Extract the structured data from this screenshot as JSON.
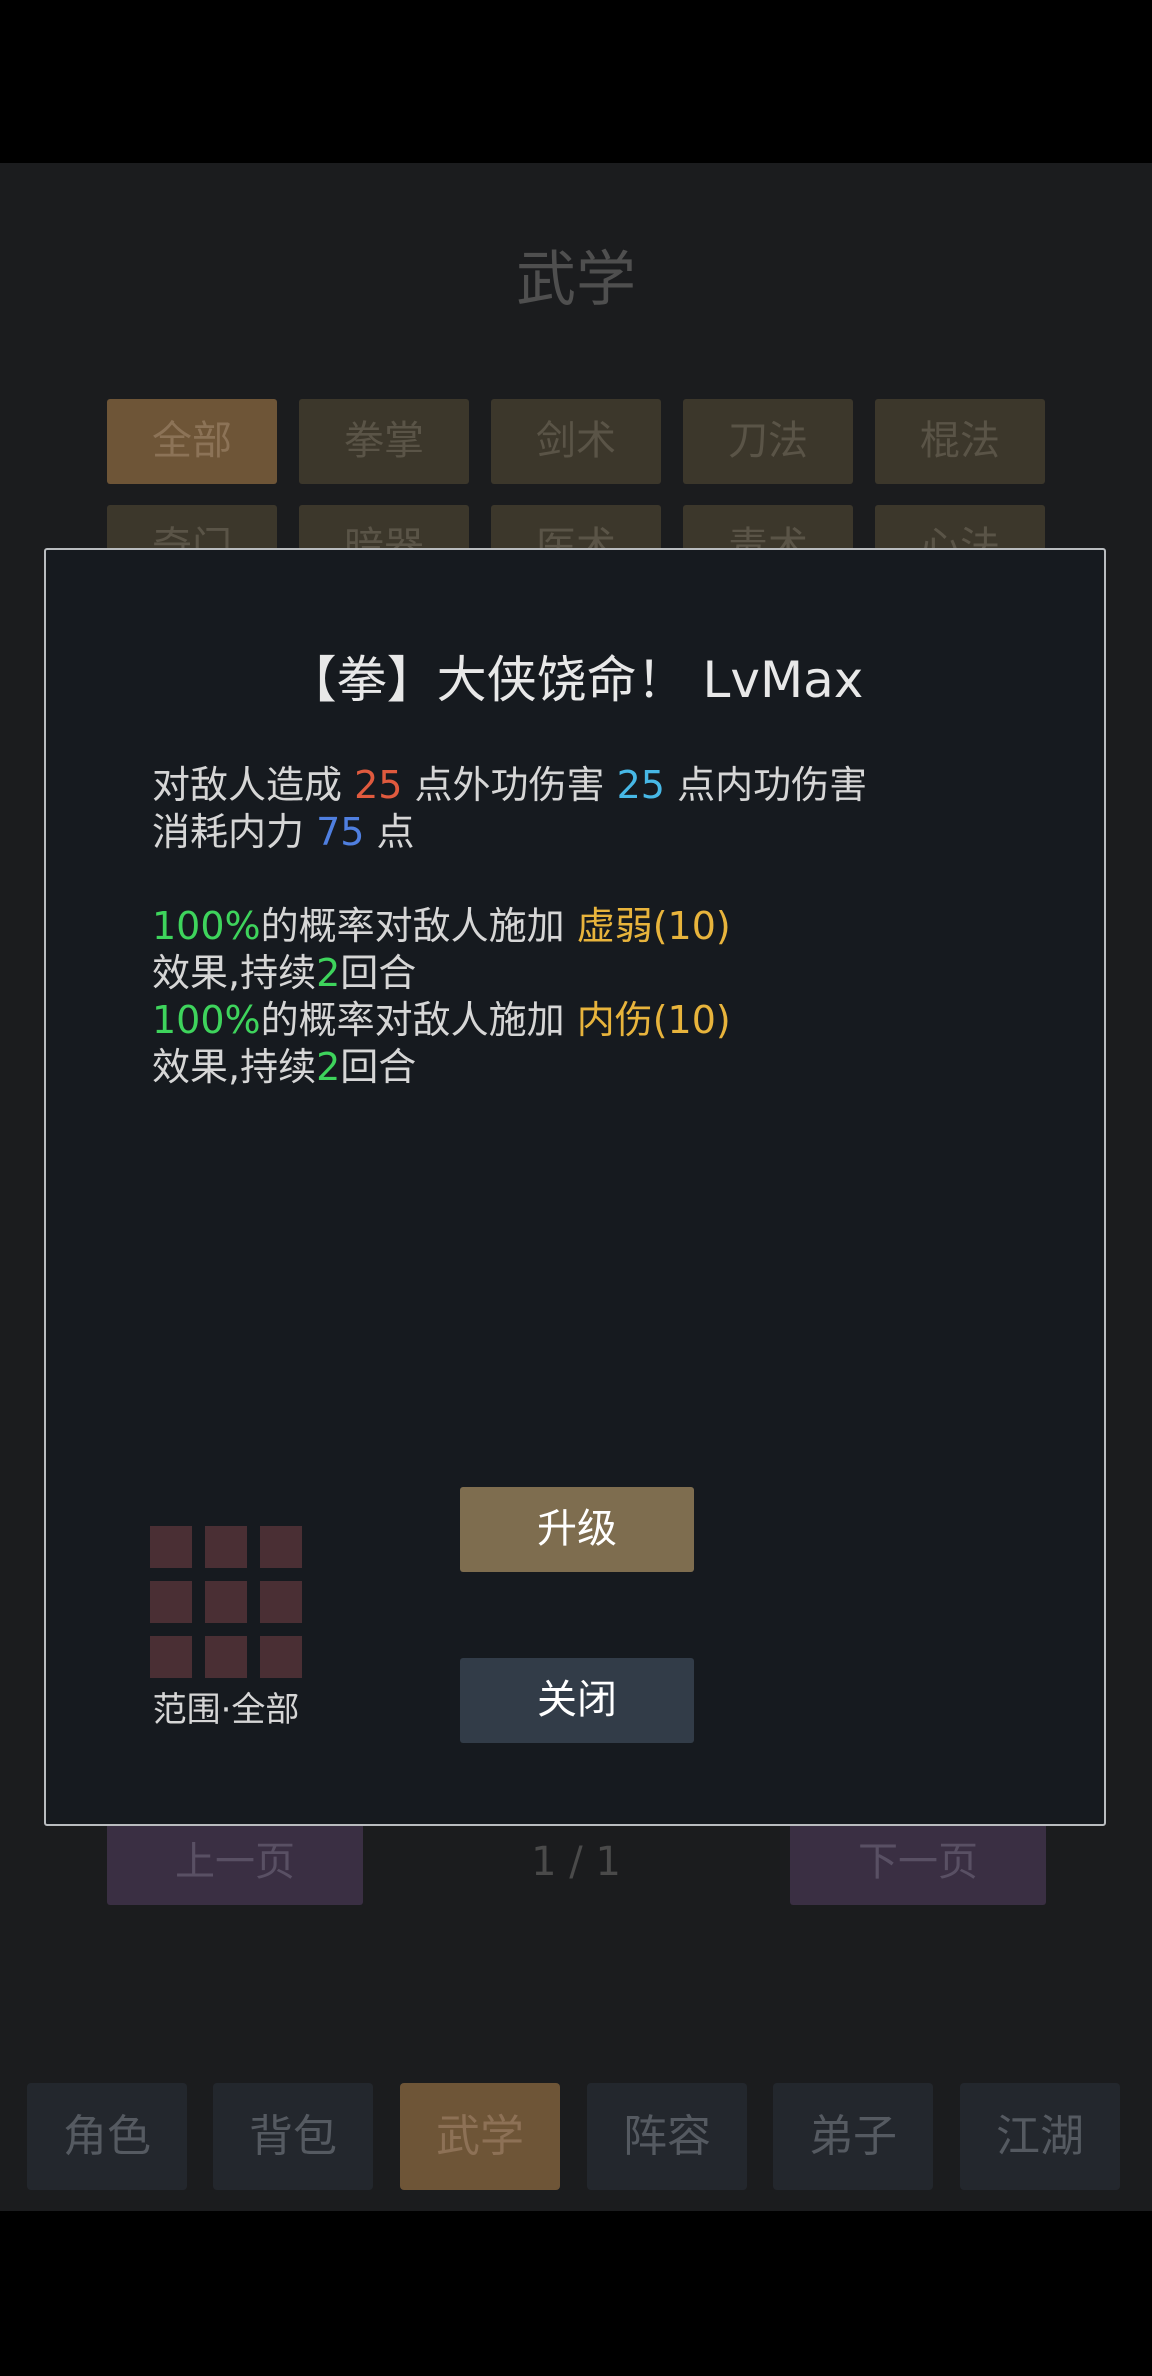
{
  "page": {
    "title": "武学"
  },
  "categories": [
    {
      "label": "全部"
    },
    {
      "label": "拳掌"
    },
    {
      "label": "剑术"
    },
    {
      "label": "刀法"
    },
    {
      "label": "棍法"
    },
    {
      "label": "奇门"
    },
    {
      "label": "暗器"
    },
    {
      "label": "医术"
    },
    {
      "label": "毒术"
    },
    {
      "label": "心法"
    }
  ],
  "pager": {
    "prev_label": "上一页",
    "page_text": "1 / 1",
    "next_label": "下一页"
  },
  "bottom_nav": [
    {
      "label": "角色"
    },
    {
      "label": "背包"
    },
    {
      "label": "武学"
    },
    {
      "label": "阵容"
    },
    {
      "label": "弟子"
    },
    {
      "label": "江湖"
    }
  ],
  "colors": {
    "damage_outer": "#e05a3e",
    "damage_inner": "#47b8e6",
    "mana": "#4f7fe0",
    "chance": "#3ed45c",
    "effect": "#e8b43c"
  },
  "modal": {
    "title": "【拳】大侠饶命！ LvMax",
    "desc": {
      "line1_a": "对敌人造成 ",
      "outer_damage": "25",
      "line1_b": " 点外功伤害 ",
      "inner_damage": "25",
      "line1_c": " 点内功伤害",
      "line2_a": "消耗内力 ",
      "mana_cost": "75",
      "line2_b": " 点",
      "effects": [
        {
          "chance": "100%",
          "text_a": "的概率对敌人施加 ",
          "effect": "虚弱(10)",
          "text_b": "效果,持续",
          "turns": "2",
          "text_c": "回合"
        },
        {
          "chance": "100%",
          "text_a": "的概率对敌人施加 ",
          "effect": "内伤(10)",
          "text_b": "效果,持续",
          "turns": "2",
          "text_c": "回合"
        }
      ]
    },
    "range_label": "范围·全部",
    "upgrade_label": "升级",
    "close_label": "关闭"
  }
}
